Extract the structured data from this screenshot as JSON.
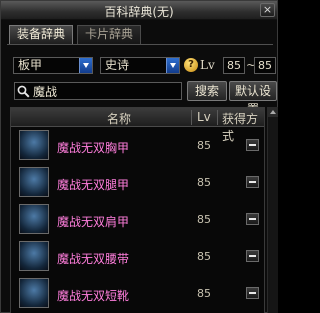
{
  "window": {
    "title": "百科辞典(无)",
    "close_glyph": "×"
  },
  "tabs": [
    {
      "label": "装备辞典",
      "active": true
    },
    {
      "label": "卡片辞典",
      "active": false
    }
  ],
  "filters": {
    "category": "板甲",
    "rarity": "史诗",
    "help_glyph": "?",
    "lv_label": "Lv",
    "lv_min": "85",
    "lv_separator": "~",
    "lv_max": "85"
  },
  "search": {
    "value": "魔战",
    "search_button": "搜索",
    "reset_button": "默认设置"
  },
  "table": {
    "headers": {
      "name": "名称",
      "lv": "Lv",
      "source": "获得方式"
    },
    "rows": [
      {
        "name": "魔战无双胸甲",
        "lv": "85"
      },
      {
        "name": "魔战无双腿甲",
        "lv": "85"
      },
      {
        "name": "魔战无双肩甲",
        "lv": "85"
      },
      {
        "name": "魔战无双腰带",
        "lv": "85"
      },
      {
        "name": "魔战无双短靴",
        "lv": "85"
      }
    ]
  },
  "colors": {
    "epic_name": "#ff7edc",
    "accent_blue": "#2f6fd0"
  },
  "icons": {
    "close": "close-icon",
    "search": "search-icon",
    "help": "help-icon",
    "dropdown": "chevron-down-icon",
    "minus": "minus-icon"
  }
}
